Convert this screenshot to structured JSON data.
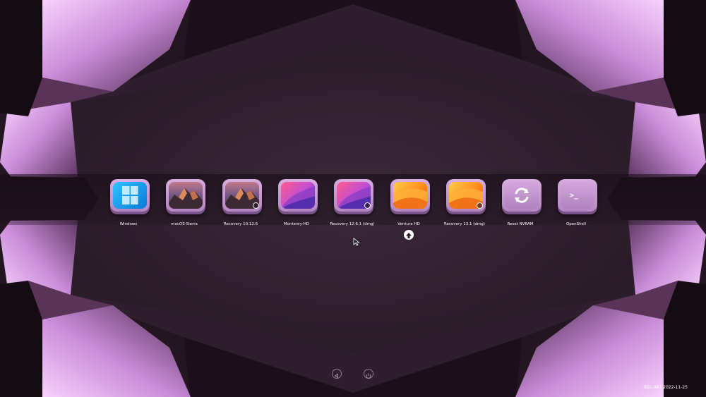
{
  "boot_entries": [
    {
      "label": "Windows",
      "icon": "windows-logo-icon",
      "style": "win"
    },
    {
      "label": "macOS-Sierra",
      "icon": "macos-sierra-icon",
      "style": "sierra"
    },
    {
      "label": "Recovery 10.12.6",
      "icon": "sierra-recovery-icon",
      "style": "sierra",
      "badge": true
    },
    {
      "label": "Monterey-HD",
      "icon": "monterey-icon",
      "style": "monterey"
    },
    {
      "label": "Recovery 12.6.1 (dmg)",
      "icon": "monterey-recovery-icon",
      "style": "monterey",
      "badge": true
    },
    {
      "label": "Ventura HD",
      "icon": "ventura-icon",
      "style": "ventura",
      "selected": true
    },
    {
      "label": "Recovery 13.1 (dmg)",
      "icon": "ventura-recovery-icon",
      "style": "ventura",
      "badge": true
    },
    {
      "label": "Reset NVRAM",
      "icon": "reset-nvram-icon",
      "style": "util"
    },
    {
      "label": "OpenShell",
      "icon": "terminal-icon",
      "style": "util"
    }
  ],
  "footer": {
    "version": "REL-087-2022-11-25",
    "left_button_icon": "restart-icon",
    "right_button_icon": "shutdown-icon"
  },
  "selection": {
    "icon": "selection-arrow-icon",
    "selected_label": "Ventura HD"
  },
  "colors": {
    "background": "#2c1d2b",
    "accent": "#e4b4f2",
    "tile": "#c79bd4",
    "text": "#ffffff"
  }
}
